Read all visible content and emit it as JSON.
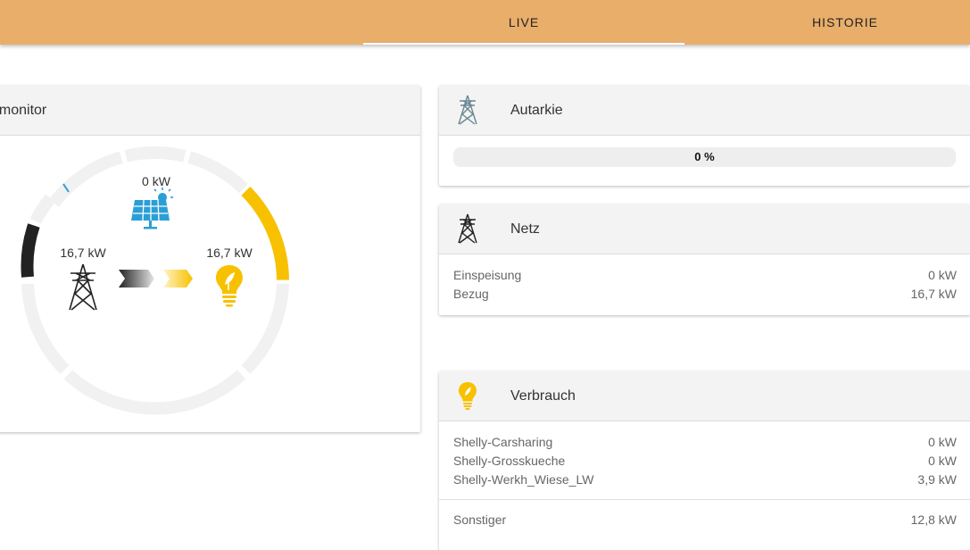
{
  "tabs": {
    "live": "LIVE",
    "historie": "HISTORIE"
  },
  "monitor": {
    "title": "emonitor",
    "solar_value": "0 kW",
    "grid_value": "16,7 kW",
    "consumption_value": "16,7 kW"
  },
  "autarkie": {
    "title": "Autarkie",
    "percent": "0 %",
    "fraction": 0
  },
  "netz": {
    "title": "Netz",
    "rows": [
      {
        "label": "Einspeisung",
        "value": "0 kW"
      },
      {
        "label": "Bezug",
        "value": "16,7 kW"
      }
    ]
  },
  "verbrauch": {
    "title": "Verbrauch",
    "rows": [
      {
        "label": "Shelly-Carsharing",
        "value": "0 kW"
      },
      {
        "label": "Shelly-Grosskueche",
        "value": "0 kW"
      },
      {
        "label": "Shelly-Werkh_Wiese_LW",
        "value": "3,9 kW"
      },
      {
        "label": "Sonstiger",
        "value": "12,8 kW"
      }
    ]
  },
  "colors": {
    "header": "#e8ae6a",
    "solar": "#2a9fd6",
    "consumption": "#f7c100",
    "grid": "#222222"
  }
}
